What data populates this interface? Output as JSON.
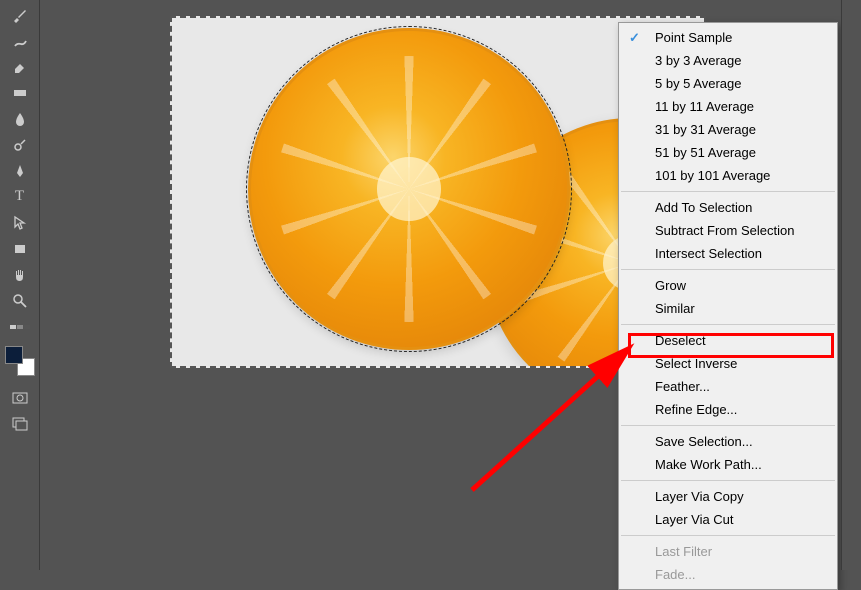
{
  "toolbar_tools": [
    "brush",
    "heal",
    "clone",
    "blur",
    "dodge",
    "pen",
    "text",
    "path-select",
    "rectangle",
    "hand",
    "zoom"
  ],
  "context_menu": {
    "group1": [
      {
        "label": "Point Sample",
        "checked": true
      },
      {
        "label": "3 by 3 Average"
      },
      {
        "label": "5 by 5 Average"
      },
      {
        "label": "11 by 11 Average"
      },
      {
        "label": "31 by 31 Average"
      },
      {
        "label": "51 by 51 Average"
      },
      {
        "label": "101 by 101 Average"
      }
    ],
    "group2": [
      {
        "label": "Add To Selection"
      },
      {
        "label": "Subtract From Selection"
      },
      {
        "label": "Intersect Selection"
      }
    ],
    "group3": [
      {
        "label": "Grow"
      },
      {
        "label": "Similar"
      }
    ],
    "group4": [
      {
        "label": "Deselect"
      },
      {
        "label": "Select Inverse"
      },
      {
        "label": "Feather..."
      },
      {
        "label": "Refine Edge..."
      }
    ],
    "group5": [
      {
        "label": "Save Selection..."
      },
      {
        "label": "Make Work Path..."
      }
    ],
    "group6": [
      {
        "label": "Layer Via Copy"
      },
      {
        "label": "Layer Via Cut"
      }
    ],
    "group7": [
      {
        "label": "Last Filter",
        "disabled": true
      },
      {
        "label": "Fade...",
        "disabled": true
      }
    ]
  },
  "colors": {
    "foreground": "#0c1e3a",
    "background": "#ffffff",
    "highlight": "#ff0000"
  }
}
